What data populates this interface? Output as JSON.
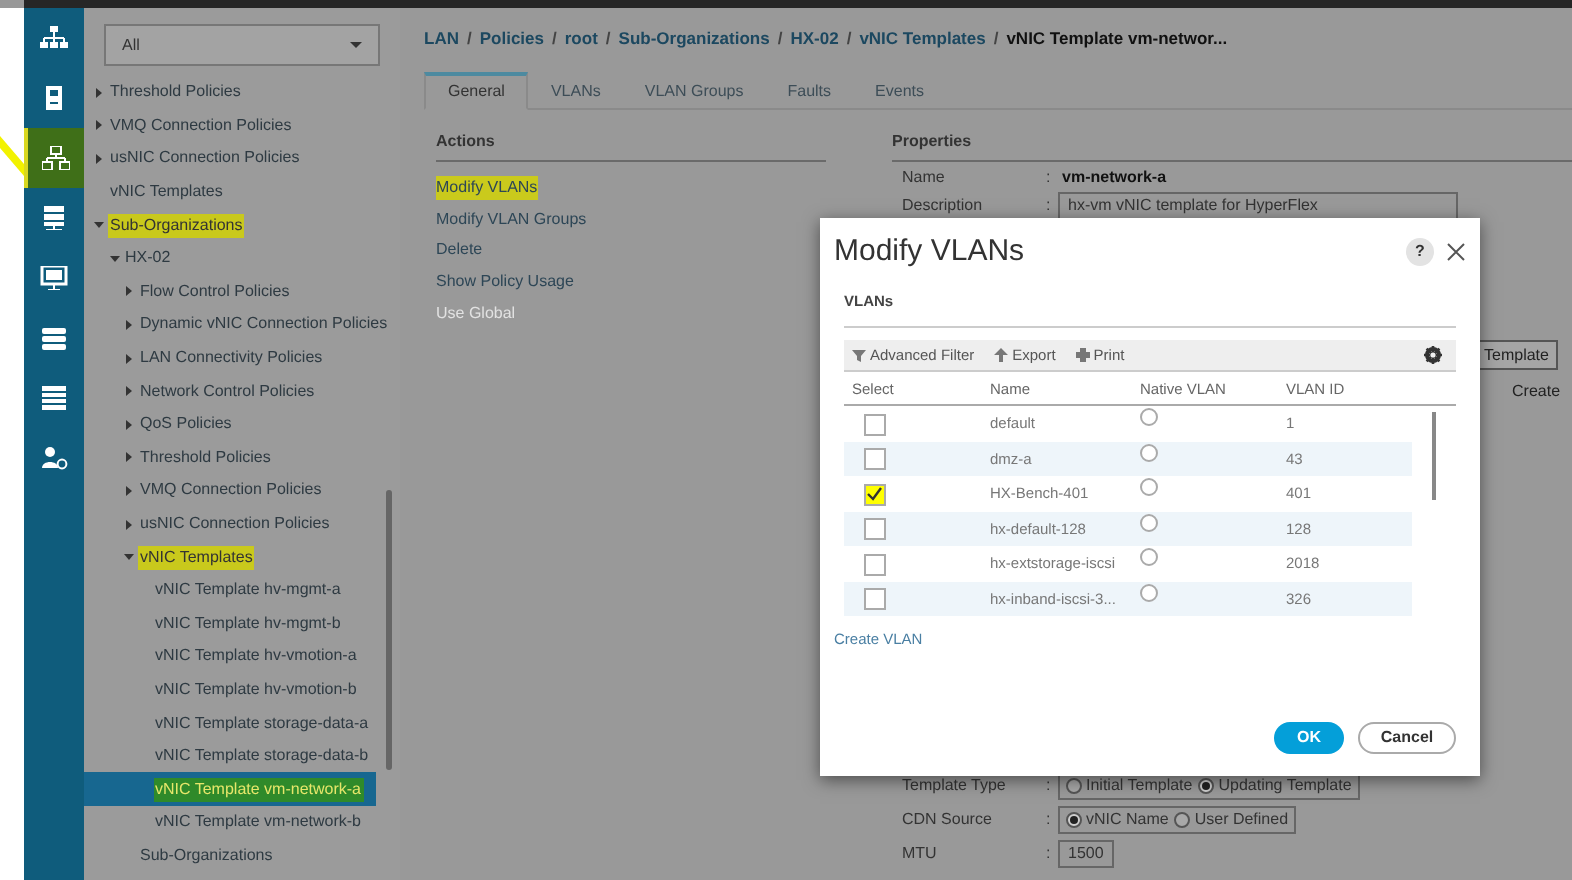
{
  "rail": [
    {
      "kind": "topology",
      "selected": false,
      "highlighted": false
    },
    {
      "kind": "server",
      "selected": false,
      "highlighted": false
    },
    {
      "kind": "network",
      "selected": true,
      "highlighted": true
    },
    {
      "kind": "rack",
      "selected": false,
      "highlighted": false
    },
    {
      "kind": "monitor",
      "selected": false,
      "highlighted": false
    },
    {
      "kind": "storage",
      "selected": false,
      "highlighted": false
    },
    {
      "kind": "list",
      "selected": false,
      "highlighted": false
    },
    {
      "kind": "admin",
      "selected": false,
      "highlighted": false
    }
  ],
  "tree_filter": {
    "value": "All"
  },
  "tree": [
    {
      "label": "Threshold Policies",
      "expanded": false,
      "selected": false,
      "highlighted": false
    },
    {
      "label": "VMQ Connection Policies",
      "expanded": false,
      "selected": false,
      "highlighted": false
    },
    {
      "label": "usNIC Connection Policies",
      "expanded": false,
      "selected": false,
      "highlighted": false
    },
    {
      "label": "vNIC Templates",
      "selected": false,
      "highlighted": false
    },
    {
      "label": "Sub-Organizations",
      "expanded": true,
      "selected": false,
      "highlighted": true,
      "children": [
        {
          "label": "HX-02",
          "expanded": true,
          "selected": false,
          "highlighted": false,
          "children": [
            {
              "label": "Flow Control Policies",
              "expanded": false,
              "selected": false,
              "highlighted": false
            },
            {
              "label": "Dynamic vNIC Connection Policies",
              "expanded": false,
              "selected": false,
              "highlighted": false
            },
            {
              "label": "LAN Connectivity Policies",
              "expanded": false,
              "selected": false,
              "highlighted": false
            },
            {
              "label": "Network Control Policies",
              "expanded": false,
              "selected": false,
              "highlighted": false
            },
            {
              "label": "QoS Policies",
              "expanded": false,
              "selected": false,
              "highlighted": false
            },
            {
              "label": "Threshold Policies",
              "expanded": false,
              "selected": false,
              "highlighted": false
            },
            {
              "label": "VMQ Connection Policies",
              "expanded": false,
              "selected": false,
              "highlighted": false
            },
            {
              "label": "usNIC Connection Policies",
              "expanded": false,
              "selected": false,
              "highlighted": false
            },
            {
              "label": "vNIC Templates",
              "expanded": true,
              "selected": false,
              "highlighted": true,
              "children": [
                {
                  "label": "vNIC Template hv-mgmt-a",
                  "selected": false,
                  "highlighted": false
                },
                {
                  "label": "vNIC Template hv-mgmt-b",
                  "selected": false,
                  "highlighted": false
                },
                {
                  "label": "vNIC Template hv-vmotion-a",
                  "selected": false,
                  "highlighted": false
                },
                {
                  "label": "vNIC Template hv-vmotion-b",
                  "selected": false,
                  "highlighted": false
                },
                {
                  "label": "vNIC Template storage-data-a",
                  "selected": false,
                  "highlighted": false
                },
                {
                  "label": "vNIC Template storage-data-b",
                  "selected": false,
                  "highlighted": false
                },
                {
                  "label": "vNIC Template vm-network-a",
                  "selected": true,
                  "highlighted": true
                },
                {
                  "label": "vNIC Template vm-network-b",
                  "selected": false,
                  "highlighted": false
                }
              ]
            },
            {
              "label": "Sub-Organizations",
              "selected": false,
              "highlighted": false
            }
          ]
        }
      ]
    }
  ],
  "breadcrumb": [
    "LAN",
    "Policies",
    "root",
    "Sub-Organizations",
    "HX-02",
    "vNIC Templates",
    "vNIC Template vm-networ..."
  ],
  "breadcrumb_separator": "/",
  "tabs": [
    {
      "label": "General",
      "selected": true
    },
    {
      "label": "VLANs",
      "selected": false
    },
    {
      "label": "VLAN Groups",
      "selected": false
    },
    {
      "label": "Faults",
      "selected": false
    },
    {
      "label": "Events",
      "selected": false
    }
  ],
  "actions": {
    "title": "Actions",
    "items": [
      {
        "label": "Modify VLANs",
        "highlighted": true,
        "disabled": false
      },
      {
        "label": "Modify VLAN Groups",
        "highlighted": false,
        "disabled": false
      },
      {
        "label": "Delete",
        "highlighted": false,
        "disabled": false
      },
      {
        "label": "Show Policy Usage",
        "highlighted": false,
        "disabled": false
      },
      {
        "label": "Use Global",
        "highlighted": false,
        "disabled": true
      }
    ]
  },
  "properties": {
    "title": "Properties",
    "rows": [
      {
        "label": "Name",
        "separator": ":",
        "kind": "text",
        "value": "vm-network-a"
      },
      {
        "label": "Description",
        "separator": ":",
        "kind": "field",
        "value": "hx-vm vNIC template for HyperFlex"
      }
    ],
    "lower_rows": [
      {
        "label": "Template Type",
        "separator": ":",
        "kind": "radio",
        "options": [
          {
            "label": "Initial Template",
            "selected": false
          },
          {
            "label": "Updating Template",
            "selected": true
          }
        ]
      },
      {
        "label": "CDN Source",
        "separator": ":",
        "kind": "radio",
        "options": [
          {
            "label": "vNIC Name",
            "selected": true
          },
          {
            "label": "User Defined",
            "selected": false
          }
        ]
      },
      {
        "label": "MTU",
        "separator": ":",
        "kind": "field",
        "value": "1500"
      }
    ]
  },
  "side_button": "Template",
  "side_text": "Create",
  "dialog": {
    "title": "Modify VLANs",
    "help": "?",
    "section": "VLANs",
    "toolbar": [
      {
        "kind": "filter",
        "label": "Advanced Filter"
      },
      {
        "kind": "export",
        "label": "Export"
      },
      {
        "kind": "print",
        "label": "Print"
      }
    ],
    "columns": [
      "Select",
      "Name",
      "Native VLAN",
      "VLAN ID"
    ],
    "rows": [
      {
        "checked": false,
        "highlighted": false,
        "name": "default",
        "native": false,
        "vlan_id": "1"
      },
      {
        "checked": false,
        "highlighted": false,
        "name": "dmz-a",
        "native": false,
        "vlan_id": "43"
      },
      {
        "checked": true,
        "highlighted": true,
        "name": "HX-Bench-401",
        "native": false,
        "vlan_id": "401"
      },
      {
        "checked": false,
        "highlighted": false,
        "name": "hx-default-128",
        "native": false,
        "vlan_id": "128"
      },
      {
        "checked": false,
        "highlighted": false,
        "name": "hx-extstorage-iscsi",
        "native": false,
        "vlan_id": "2018"
      },
      {
        "checked": false,
        "highlighted": false,
        "name": "hx-inband-iscsi-3...",
        "native": false,
        "vlan_id": "326"
      }
    ],
    "link": "Create VLAN",
    "buttons": [
      {
        "kind": "primary",
        "label": "OK"
      },
      {
        "kind": "secondary",
        "label": "Cancel"
      }
    ]
  }
}
